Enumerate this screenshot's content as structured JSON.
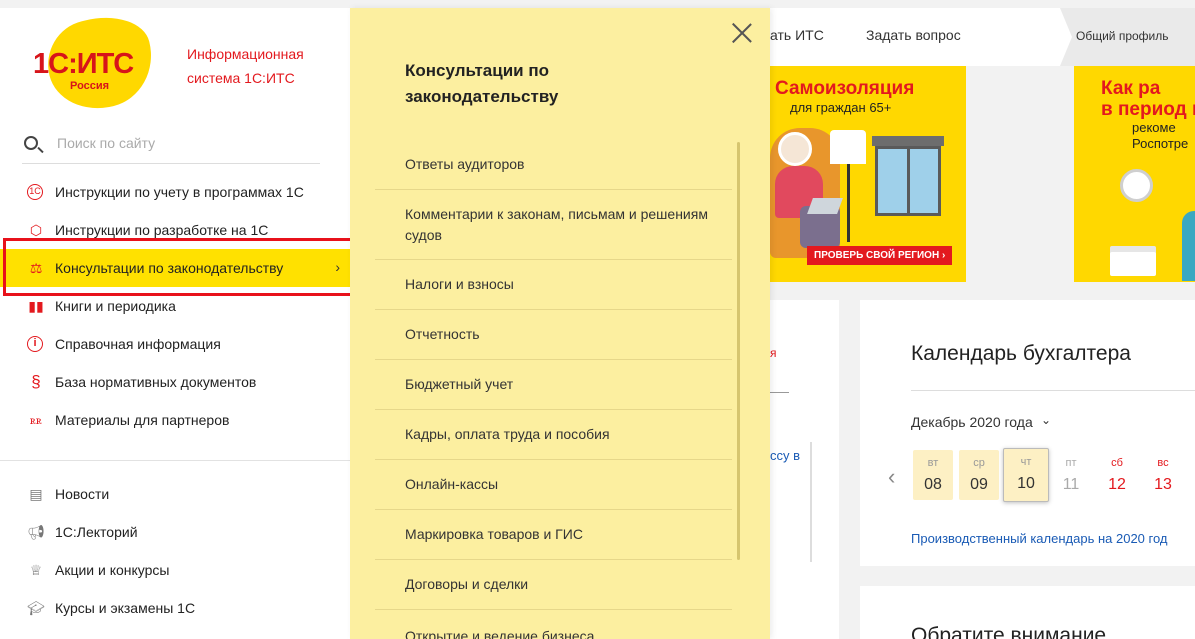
{
  "header": {
    "nav_its": "ать ИТС",
    "nav_ask": "Задать вопрос",
    "profile": "Общий профиль"
  },
  "banners": {
    "left": {
      "title": "Самоизоляция",
      "subtitle": "для граждан 65+",
      "cta": "ПРОВЕРЬ СВОЙ РЕГИОН ›"
    },
    "right": {
      "title": "Как ра\nв период п",
      "subtitle": "рекоме\nРоспотре"
    }
  },
  "left_card": {
    "fragment1": "я",
    "fragment2": "ссу в"
  },
  "calendar": {
    "title": "Календарь бухгалтера",
    "month": "Декабрь 2020 года",
    "days": [
      {
        "name": "вт",
        "num": "08"
      },
      {
        "name": "ср",
        "num": "09"
      },
      {
        "name": "чт",
        "num": "10"
      },
      {
        "name": "пт",
        "num": "11"
      },
      {
        "name": "сб",
        "num": "12"
      },
      {
        "name": "вс",
        "num": "13"
      }
    ],
    "link": "Производственный календарь на 2020 год"
  },
  "attention": {
    "title": "Обратите внимание"
  },
  "sidebar": {
    "logo_text": "1С:ИТС",
    "logo_sub": "Россия",
    "title": "Информационная система 1С:ИТС",
    "search_placeholder": "Поиск по сайту",
    "items": [
      {
        "label": "Инструкции по учету в программах 1С",
        "icon": "1c-icon"
      },
      {
        "label": "Инструкции по разработке на 1С",
        "icon": "cube-icon"
      },
      {
        "label": "Консультации по законодательству",
        "icon": "scales-icon"
      },
      {
        "label": "Книги и периодика",
        "icon": "books-icon"
      },
      {
        "label": "Справочная информация",
        "icon": "info-icon"
      },
      {
        "label": "База нормативных документов",
        "icon": "section-icon"
      },
      {
        "label": "Материалы для партнеров",
        "icon": "partners-icon"
      }
    ],
    "items2": [
      {
        "label": "Новости",
        "icon": "news-icon"
      },
      {
        "label": "1С:Лекторий",
        "icon": "megaphone-icon"
      },
      {
        "label": "Акции и конкурсы",
        "icon": "trophy-icon"
      },
      {
        "label": "Курсы и экзамены 1С",
        "icon": "graduation-icon"
      }
    ]
  },
  "submenu": {
    "title": "Консультации по законодательству",
    "items": [
      "Ответы аудиторов",
      "Комментарии к законам, письмам и решениям судов",
      "Налоги и взносы",
      "Отчетность",
      "Бюджетный учет",
      "Кадры, оплата труда и пособия",
      "Онлайн-кассы",
      "Маркировка товаров и ГИС",
      "Договоры и сделки"
    ],
    "partial": "Открытие и ведение бизнеса"
  },
  "colors": {
    "accent_yellow": "#ffe100",
    "brand_red": "#e3191e",
    "submenu_bg": "#fcefa0"
  }
}
